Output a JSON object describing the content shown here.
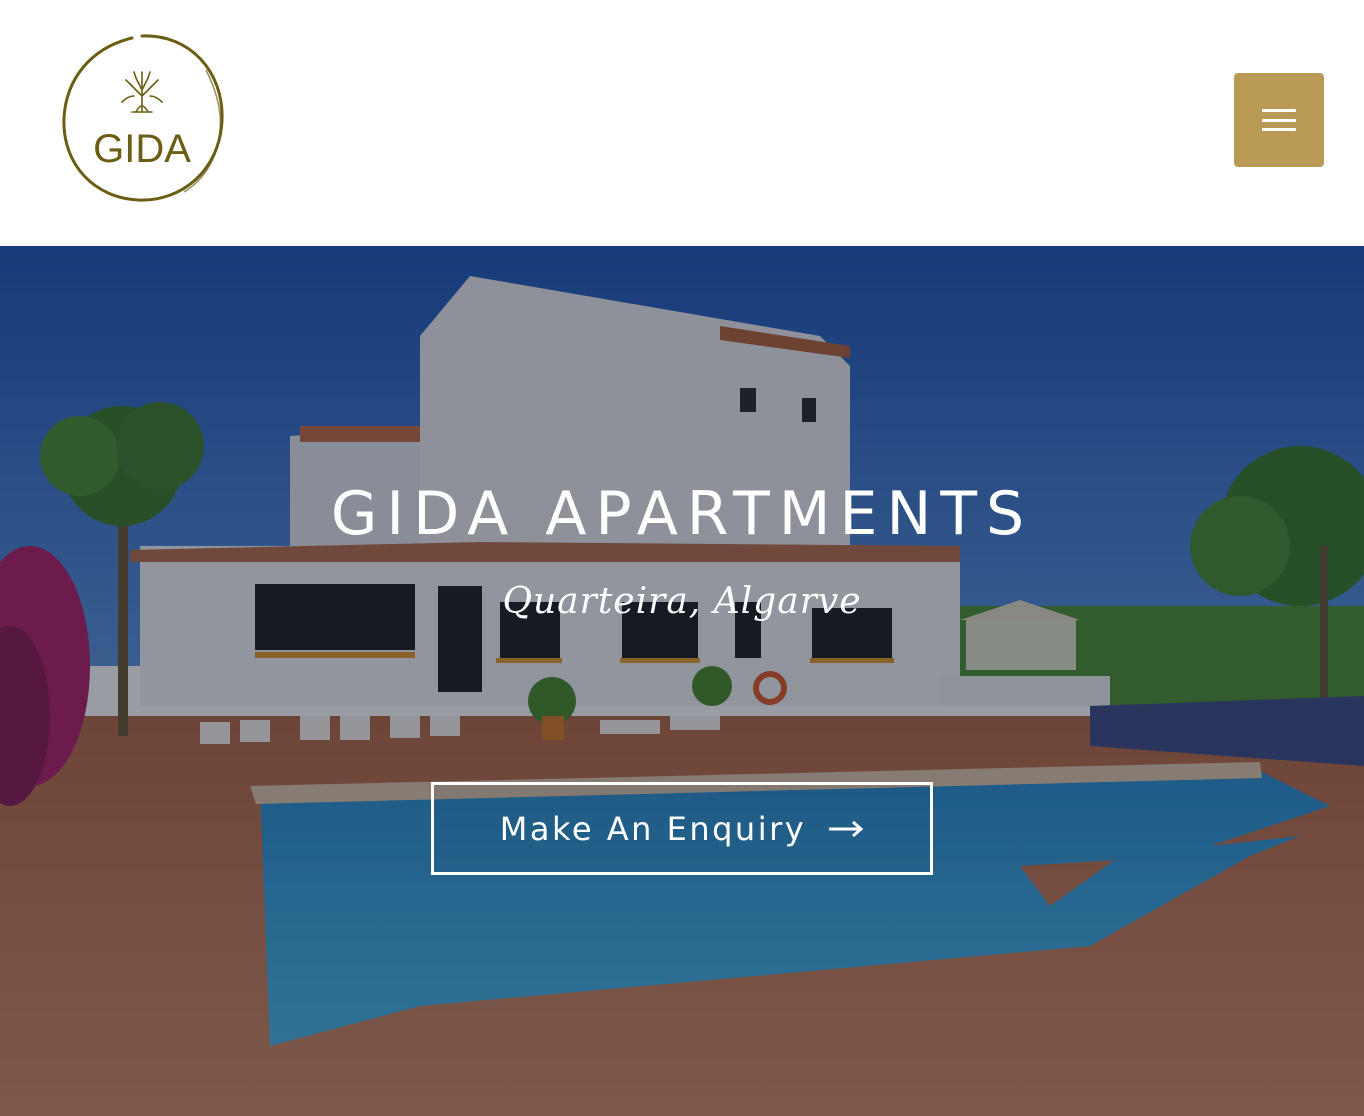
{
  "header": {
    "logo_text": "GIDA",
    "menu_button_label": "menu-icon"
  },
  "hero": {
    "title": "GIDA APARTMENTS",
    "subtitle": "Quarteira, Algarve",
    "cta_label": "Make An Enquiry",
    "cta_icon": "arrow-right-icon",
    "background_description_colors": {
      "sky": "#2f6fc8",
      "building": "#eef0f2",
      "pool": "#2aa3dd",
      "deck": "#c8785a",
      "foliage": "#3e7a2e"
    }
  },
  "colors": {
    "accent": "#b99a55",
    "logo_olive": "#6b5e14",
    "text_light": "#ffffff"
  }
}
